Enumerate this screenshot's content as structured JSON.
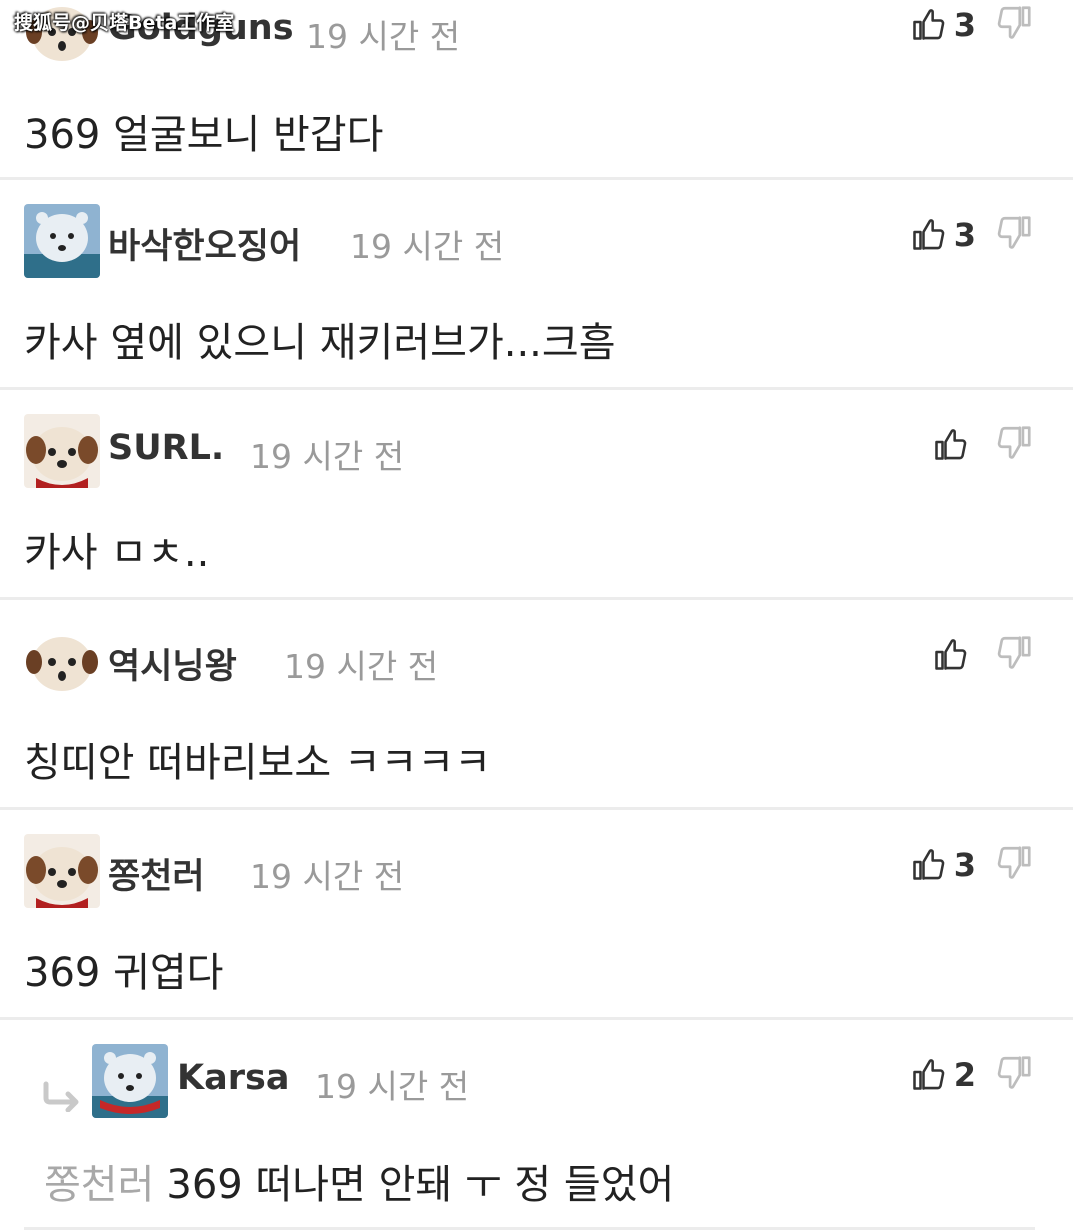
{
  "watermark": "搜狐号@贝塔Beta工作室",
  "comments": [
    {
      "username": "Goldguns",
      "time": "19 시간 전",
      "likes": "3",
      "text": "369 얼굴보니 반갑다"
    },
    {
      "username": "바삭한오징어",
      "time": "19 시간 전",
      "likes": "3",
      "text": "카사 옆에 있으니 재키러브가...크흠"
    },
    {
      "username": "SURL.",
      "time": "19 시간 전",
      "likes": "",
      "text": "카사 ㅁㅊ.."
    },
    {
      "username": "역시닝왕",
      "time": "19 시간 전",
      "likes": "",
      "text": "칭띠안 떠바리보소 ㅋㅋㅋㅋ"
    },
    {
      "username": "쫑천러",
      "time": "19 시간 전",
      "likes": "3",
      "text": "369 귀엽다"
    },
    {
      "username": "Karsa",
      "time": "19 시간 전",
      "likes": "2",
      "mention": "쫑천러",
      "text": "369 떠나면 안돼 ㅜ 정 들었어",
      "is_reply": true
    }
  ],
  "icons": {
    "like": "thumbs-up-icon",
    "dislike": "thumbs-down-icon",
    "reply": "reply-arrow-icon"
  },
  "colors": {
    "timestamp": "#9a9a9a",
    "mention": "#a8a8a8",
    "divider": "#ececec"
  }
}
